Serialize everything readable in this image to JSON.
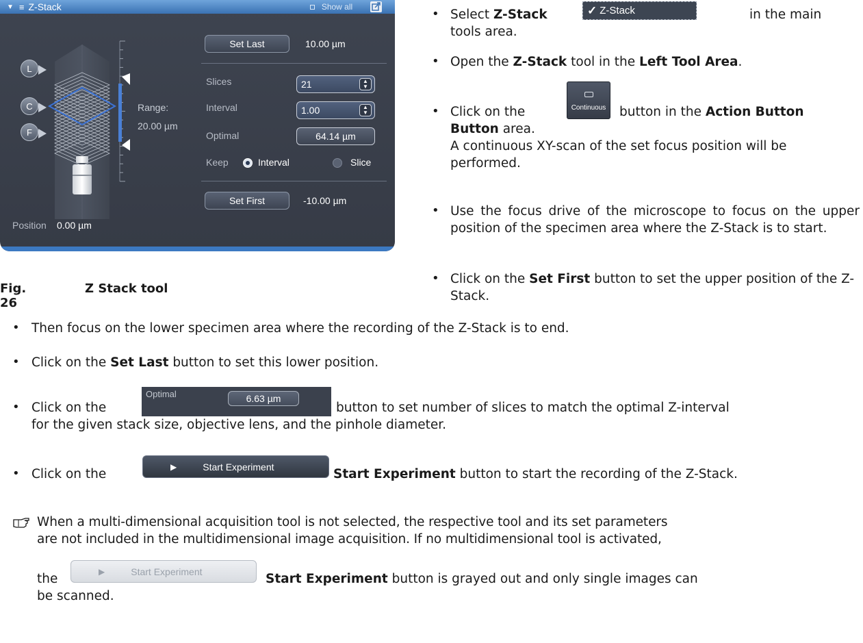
{
  "panel": {
    "title": "Z-Stack",
    "show_all": "Show all",
    "set_last": {
      "label": "Set Last",
      "value": "10.00 µm"
    },
    "slices": {
      "label": "Slices",
      "value": "21"
    },
    "interval": {
      "label": "Interval",
      "value": "1.00"
    },
    "optimal": {
      "label": "Optimal",
      "value": "64.14 µm"
    },
    "keep": {
      "label": "Keep",
      "option1": "Interval",
      "option2": "Slice",
      "selected": "Interval"
    },
    "set_first": {
      "label": "Set First",
      "value": "-10.00 µm"
    },
    "range": {
      "label": "Range:",
      "value": "20.00 µm"
    },
    "position": {
      "label": "Position",
      "value": "0.00 µm"
    },
    "markers": [
      "L",
      "C",
      "F"
    ],
    "colors": {
      "header": "#4f8ccc",
      "panel": "#3a3f4a",
      "focus_line": "#3c73d6"
    }
  },
  "caption": {
    "number": "Fig. 26",
    "text": "Z Stack tool"
  },
  "steps": {
    "s1": {
      "pre": "Select ",
      "bold": "Z-Stack",
      "post": " in the main tools area.",
      "button": "Z-Stack"
    },
    "s2": {
      "pre": "Open the ",
      "bold1": "Z-Stack",
      "mid": " tool in the ",
      "bold2": "Left Tool Area",
      "post": "."
    },
    "s3": {
      "pre": "Click on the ",
      "post": " button in the ",
      "bold": "Action Button",
      "post2": " area.",
      "note": "A continuous XY-scan of the set focus position will be performed.",
      "button": "Continuous"
    },
    "s4": {
      "text": "Use the focus drive of the microscope to focus on the upper position of the specimen area where the Z-Stack is to start."
    },
    "s5": {
      "pre": "Click on the ",
      "bold": "Set First",
      "post": " button to set the upper position of the Z-Stack."
    },
    "s6": {
      "text": "Then focus on the lower specimen area where the recording of the Z-Stack is to end."
    },
    "s7": {
      "pre": "Click on the ",
      "bold": "Set Last",
      "post": " button to set this lower position."
    },
    "s8": {
      "pre": "Click on the ",
      "post": " button to set number of slices to match the optimal Z-interval for the given stack size, objective lens, and the pinhole diameter.",
      "button_label": "Optimal",
      "button_value": "6.63 µm"
    },
    "s9": {
      "pre": "Click on the ",
      "bold": "Start Experiment",
      "post": " button to start the recording of the Z-Stack.",
      "button": "Start Experiment"
    }
  },
  "note": {
    "icon": "pointing-hand-icon",
    "line1": "When a multi-dimensional acquisition tool is not selected, the respective tool and its set parameters",
    "line2": "are not included in the multidimensional image acquisition. If no multidimensional tool is activated,",
    "pre": "the ",
    "button": "Start Experiment",
    "bold": "Start Experiment",
    "post": " button is grayed out and only single images can",
    "line4": "be scanned."
  }
}
